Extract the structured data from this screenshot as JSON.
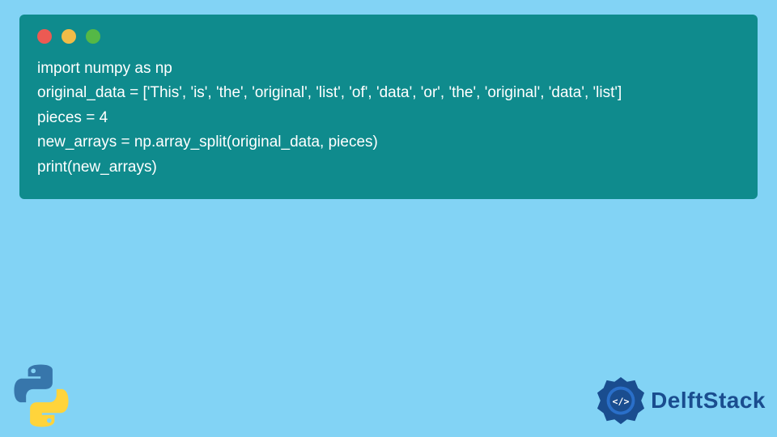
{
  "code": {
    "lines": [
      "import numpy as np",
      "original_data = ['This', 'is', 'the', 'original', 'list', 'of', 'data', 'or', 'the', 'original', 'data', 'list']",
      "pieces = 4",
      "new_arrays = np.array_split(original_data, pieces)",
      "print(new_arrays)"
    ]
  },
  "branding": {
    "site_name": "DelftStack"
  },
  "colors": {
    "background": "#82d3f5",
    "code_bg": "#0f8b8d",
    "code_text": "#ffffff",
    "brand_text": "#1a4d8f"
  }
}
